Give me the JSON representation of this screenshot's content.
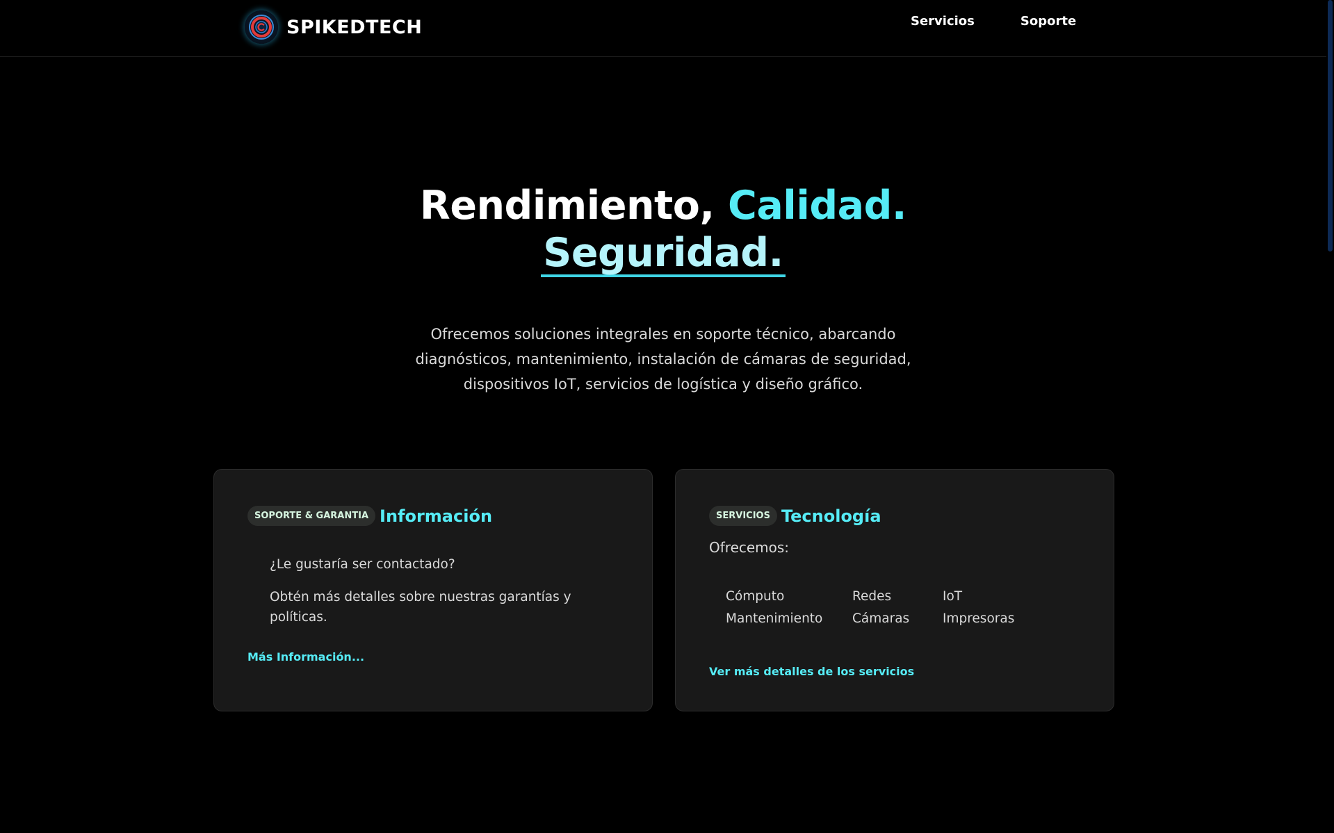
{
  "header": {
    "brand": "SPIKEDTECH",
    "logo_icon": "spikedtech-logo-icon",
    "nav": [
      "Servicios",
      "Soporte"
    ]
  },
  "hero": {
    "title_part1": "Rendimiento,",
    "title_part2": "Calidad.",
    "title_part3": "Seguridad.",
    "description": "Ofrecemos soluciones integrales en soporte técnico, abarcando diagnósticos, mantenimiento, instalación de cámaras de seguridad, dispositivos IoT, servicios de logística y diseño gráfico."
  },
  "cards": {
    "info": {
      "badge": "SOPORTE & GARANTIA",
      "title": "Información",
      "lines": [
        "¿Le gustaría ser contactado?",
        "Obtén más detalles sobre nuestras garantías y políticas."
      ],
      "link": "Más Información..."
    },
    "tech": {
      "badge": "SERVICIOS",
      "title": "Tecnología",
      "label": "Ofrecemos:",
      "items": [
        "Cómputo",
        "Redes",
        "IoT",
        "Mantenimiento",
        "Cámaras",
        "Impresoras"
      ],
      "link": "Ver más detalles de los servicios"
    }
  },
  "colors": {
    "accent": "#56ecf6",
    "background": "#000000",
    "card": "#191919",
    "badge_bg": "#2c2e2c",
    "scroll_thumb": "#0d2a55"
  }
}
